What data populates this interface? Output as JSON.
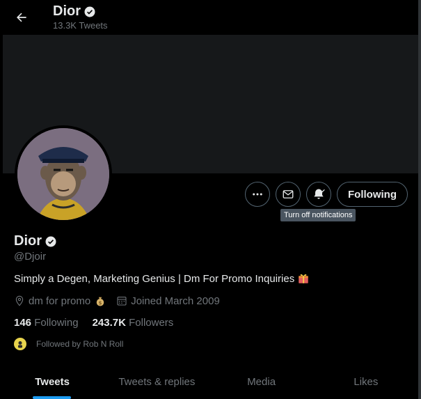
{
  "header": {
    "name": "Dior",
    "tweet_count": "13.3K Tweets"
  },
  "profile": {
    "name": "Dior",
    "handle": "@Djoir",
    "bio": "Simply a Degen, Marketing Genius | Dm For Promo Inquiries",
    "bio_emoji": "gift-icon",
    "location": "dm for promo",
    "location_emoji": "money-bag-icon",
    "joined": "Joined March 2009",
    "following_count": "146",
    "following_label": "Following",
    "followers_count": "243.7K",
    "followers_label": "Followers",
    "followed_by": "Followed by Rob N Roll"
  },
  "actions": {
    "more_icon": "more-icon",
    "message_icon": "mail-icon",
    "notifications_icon": "bell-check-icon",
    "following_label": "Following",
    "tooltip": "Turn off notifications"
  },
  "tabs": [
    {
      "label": "Tweets",
      "active": true
    },
    {
      "label": "Tweets & replies",
      "active": false
    },
    {
      "label": "Media",
      "active": false
    },
    {
      "label": "Likes",
      "active": false
    }
  ],
  "colors": {
    "background": "#000000",
    "banner": "#16181a",
    "accent": "#1d9bf0",
    "text": "#e7e9ea",
    "muted": "#71767b"
  }
}
